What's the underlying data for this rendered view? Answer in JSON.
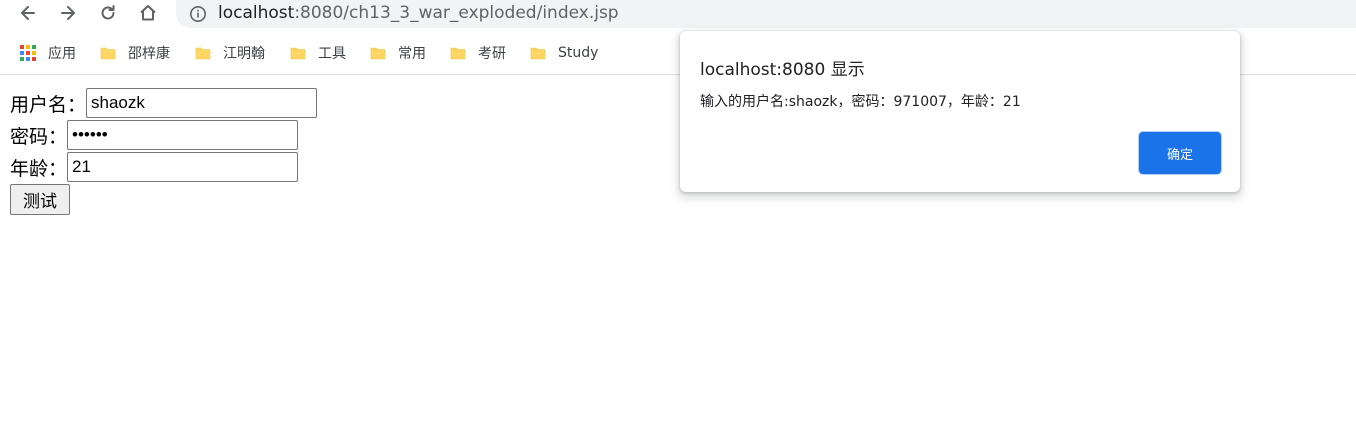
{
  "browser": {
    "url_host": "localhost",
    "url_rest": ":8080/ch13_3_war_exploded/index.jsp",
    "bookmarks": [
      {
        "label": "应用",
        "icon": "apps-grid-icon"
      },
      {
        "label": "邵梓康",
        "icon": "folder-icon"
      },
      {
        "label": "江明翰",
        "icon": "folder-icon"
      },
      {
        "label": "工具",
        "icon": "folder-icon"
      },
      {
        "label": "常用",
        "icon": "folder-icon"
      },
      {
        "label": "考研",
        "icon": "folder-icon"
      },
      {
        "label": "Study",
        "icon": "folder-icon"
      }
    ]
  },
  "form": {
    "username_label": "用户名：",
    "username_value": "shaozk",
    "password_label": "密码：",
    "password_value": "••••••",
    "age_label": "年龄：",
    "age_value": "21",
    "submit_label": "测试"
  },
  "dialog": {
    "title": "localhost:8080 显示",
    "message": "输入的用户名:shaozk，密码：971007，年龄：21",
    "ok_label": "确定"
  },
  "colors": {
    "accent": "#1a73e8",
    "folder": "#fdd663",
    "omnibox_bg": "#f1f3f4"
  }
}
